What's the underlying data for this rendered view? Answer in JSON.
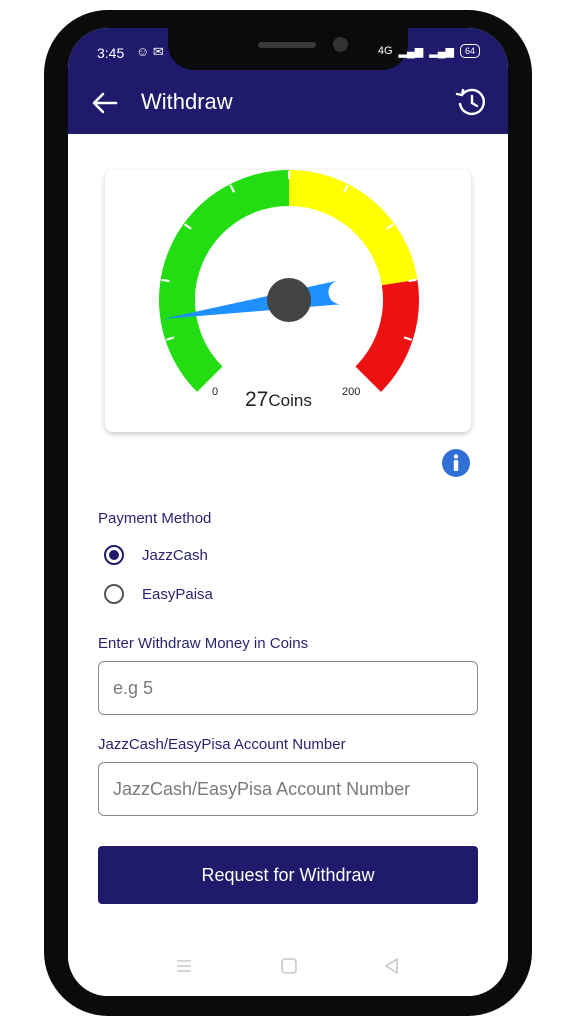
{
  "status": {
    "time": "3:45",
    "left_icons": "☺ ✉",
    "network": "4G",
    "battery": "64"
  },
  "appbar": {
    "title": "Withdraw",
    "back_icon": "arrow-left-icon",
    "history_icon": "history-icon"
  },
  "gauge": {
    "min_label": "0",
    "max_label": "200",
    "value": "27",
    "unit": "Coins",
    "colors": {
      "green": "#22dd11",
      "yellow": "#ffff00",
      "red": "#ee1111",
      "needle": "#1e90ff",
      "hub": "#444444"
    }
  },
  "info_icon": "info-icon",
  "payment": {
    "label": "Payment Method",
    "options": [
      {
        "label": "JazzCash",
        "selected": true
      },
      {
        "label": "EasyPaisa",
        "selected": false
      }
    ]
  },
  "amount": {
    "label": "Enter Withdraw Money in Coins",
    "placeholder": "e.g 5"
  },
  "account": {
    "label": "JazzCash/EasyPisa Account Number",
    "placeholder": "JazzCash/EasyPisa Account Number"
  },
  "submit_label": "Request for Withdraw",
  "theme": {
    "primary": "#1f1a6b"
  }
}
